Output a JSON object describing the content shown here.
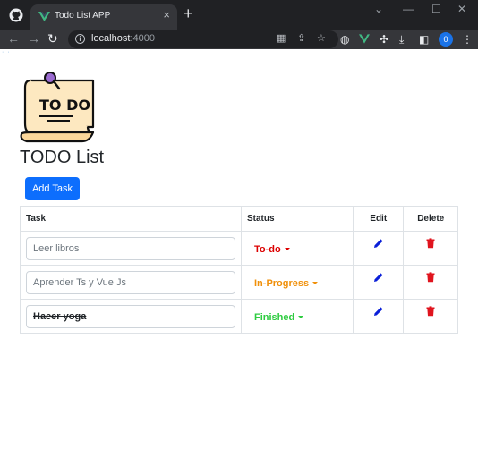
{
  "browser": {
    "tab_title": "Todo List APP",
    "tab_close": "×",
    "new_tab": "+",
    "url_host": "localhost",
    "url_port": ":4000",
    "profile_initial": "0",
    "window_controls": [
      "⌄",
      "—",
      "☐",
      "✕"
    ]
  },
  "page": {
    "logo_text": "TO DO",
    "title": "TODO List",
    "add_button": "Add Task"
  },
  "table": {
    "headers": {
      "task": "Task",
      "status": "Status",
      "edit": "Edit",
      "delete": "Delete"
    },
    "rows": [
      {
        "task": "Leer libros",
        "status": "To-do",
        "status_color": "#dc0000",
        "finished": false
      },
      {
        "task": "Aprender Ts y Vue Js",
        "status": "In-Progress",
        "status_color": "#f0900a",
        "finished": false
      },
      {
        "task": "Hacer yoga",
        "status": "Finished",
        "status_color": "#2ecc40",
        "finished": true
      }
    ]
  },
  "colors": {
    "primary": "#0d6efd",
    "edit_icon": "#0a1fd8",
    "delete_icon": "#e0141e",
    "chrome_dark": "#202124"
  },
  "icons": {
    "edit": "pencil-icon",
    "delete": "trash-icon"
  }
}
